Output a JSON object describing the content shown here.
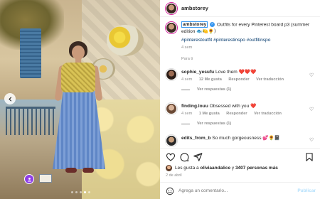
{
  "post": {
    "author": "ambstorey",
    "caption_user": "ambstorey",
    "caption_text": "Outfits for every Pinterest board p3 (summer edition",
    "caption_emojis": "🐟🍋🌻)",
    "hashtags": "#pinterestoutfit #pinterestinspo #outfitinspo",
    "caption_age": "4 sem",
    "translate": "Para ti"
  },
  "comments": [
    {
      "user": "sophie_yesufu",
      "text": "Love them",
      "emojis": "❤️❤️❤️",
      "age": "4 sem",
      "likes": "12 Me gusta",
      "reply": "Responder",
      "translate": "Ver traducción",
      "replies": "Ver respuestas (1)"
    },
    {
      "user": "finding.louu",
      "text": "Obsessed with you",
      "emojis": "❤️",
      "age": "4 sem",
      "likes": "1 Me gusta",
      "reply": "Responder",
      "translate": "Ver traducción",
      "replies": "Ver respuestas (1)"
    },
    {
      "user": "edits_from_b",
      "text": "So much gorgeousness",
      "emojis": "💕🌻📓"
    }
  ],
  "likes": {
    "prefix": "Les gusta a",
    "user": "oliviaandalice",
    "middle": "y",
    "count": "3407 personas más"
  },
  "date": "2 de abril",
  "composer": {
    "placeholder": "Agrega un comentario...",
    "publish": "Publicar"
  },
  "carousel": {
    "slides": 5,
    "active_index": 3
  },
  "colors": {
    "accent_blue": "#3897f0",
    "like_red": "#ed4956",
    "muted_text": "#8e8e8e",
    "publish_disabled": "#b2dffc"
  }
}
